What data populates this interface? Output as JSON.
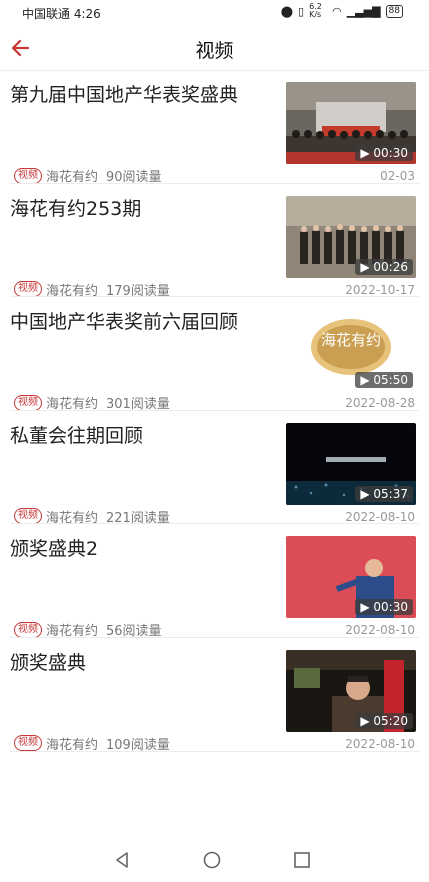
{
  "status": {
    "carrier_time": "中国联通 4:26",
    "net_speed": "6.2 K/s",
    "battery": "88"
  },
  "header": {
    "title": "视频"
  },
  "colors": {
    "accent": "#c8373a"
  },
  "items": [
    {
      "title": "第九届中国地产华表奖盛典",
      "tag": "视频",
      "author": "海花有约",
      "reads": "90阅读量",
      "duration": "00:30",
      "date": "02-03",
      "thumb": "ceremony"
    },
    {
      "title": "海花有约253期",
      "tag": "视频",
      "author": "海花有约",
      "reads": "179阅读量",
      "duration": "00:26",
      "date": "2022-10-17",
      "thumb": "group-photo"
    },
    {
      "title": "中国地产华表奖前六届回顾",
      "tag": "视频",
      "author": "海花有约",
      "reads": "301阅读量",
      "duration": "05:50",
      "date": "2022-08-28",
      "thumb": "logo"
    },
    {
      "title": "私董会往期回顾",
      "tag": "视频",
      "author": "海花有约",
      "reads": "221阅读量",
      "duration": "05:37",
      "date": "2022-08-10",
      "thumb": "dark-stage"
    },
    {
      "title": "颁奖盛典2",
      "tag": "视频",
      "author": "海花有约",
      "reads": "56阅读量",
      "duration": "00:30",
      "date": "2022-08-10",
      "thumb": "red-stage"
    },
    {
      "title": "颁奖盛典",
      "tag": "视频",
      "author": "海花有约",
      "reads": "109阅读量",
      "duration": "05:20",
      "date": "2022-08-10",
      "thumb": "interview"
    }
  ],
  "thumb_logo_text": "海花有约"
}
